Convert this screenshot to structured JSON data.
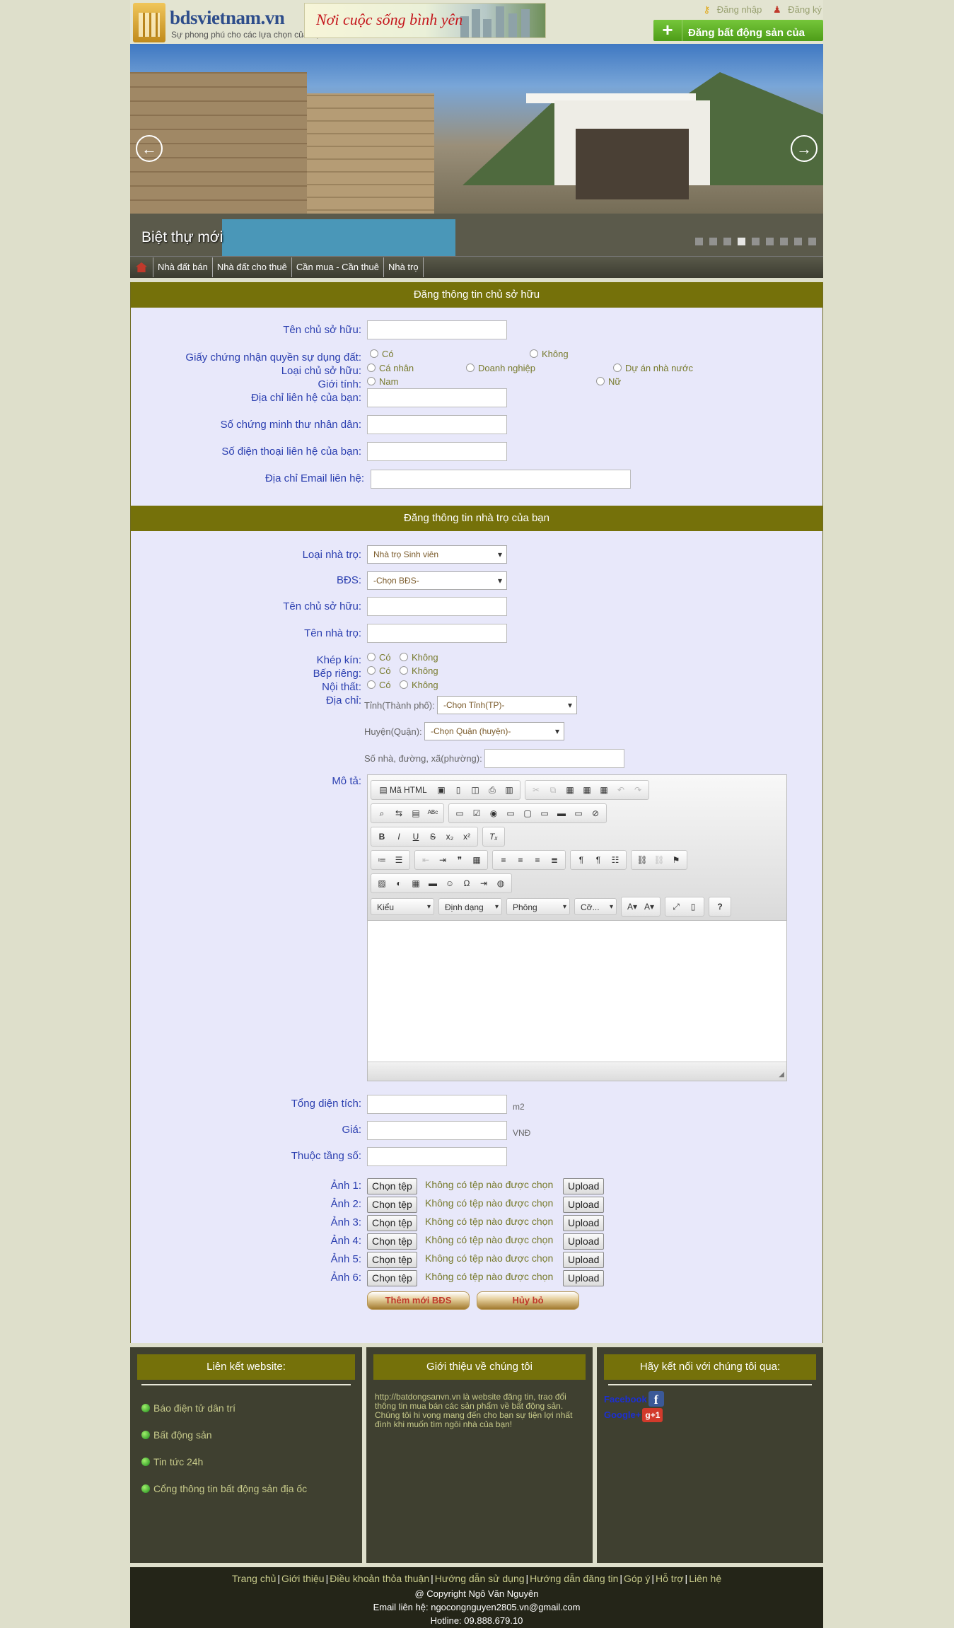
{
  "header": {
    "logo_name": "bdsvietnam.vn",
    "logo_slogan": "Sự phong phú cho các lựa chọn của bạn",
    "banner_text": "Nơi cuộc sống bình yên",
    "login": "Đăng nhập",
    "register": "Đăng ký",
    "post_button": "Đăng bất động sản của bạn"
  },
  "slider": {
    "caption": "Biệt thự mới",
    "dot_count": 9,
    "active_dot": 3
  },
  "nav": {
    "items": [
      "Nhà đất bán",
      "Nhà đất cho thuê",
      "Cần mua - Cần thuê",
      "Nhà trọ"
    ]
  },
  "owner_form": {
    "title": "Đăng thông tin chủ sở hữu",
    "owner_name_label": "Tên chủ sở hữu:",
    "certificate_label": "Giấy chứng nhận quyền sự dụng đất:",
    "certificate_options": [
      "Có",
      "Không"
    ],
    "owner_type_label": "Loại chủ sở hữu:",
    "owner_type_options": [
      "Cá nhân",
      "Doanh nghiệp",
      "Dự án nhà nước"
    ],
    "gender_label": "Giới tính:",
    "gender_options": [
      "Nam",
      "Nữ"
    ],
    "address_label": "Địa chỉ liên hệ của bạn:",
    "id_label": "Số chứng minh thư nhân dân:",
    "phone_label": "Số điện thoại liên hệ của bạn:",
    "email_label": "Địa chỉ Email liên hệ:"
  },
  "room_form": {
    "title": "Đăng thông tin nhà trọ của bạn",
    "room_type_label": "Loại nhà trọ:",
    "room_type_value": "Nhà trọ Sinh viên",
    "bds_label": "BĐS:",
    "bds_value": "-Chọn BĐS-",
    "owner_name_label": "Tên chủ sở hữu:",
    "room_name_label": "Tên nhà trọ:",
    "closed_label": "Khép kín:",
    "kitchen_label": "Bếp riêng:",
    "furniture_label": "Nội thất:",
    "yes": "Có",
    "no": "Không",
    "address_label": "Địa chỉ:",
    "province_label": "Tỉnh(Thành phố):",
    "province_value": "-Chọn Tỉnh(TP)-",
    "district_label": "Huyện(Quận):",
    "district_value": "-Chọn Quận (huyện)-",
    "street_label": "Số nhà, đường, xã(phường):",
    "description_label": "Mô tả:",
    "area_label": "Tổng diện tích:",
    "area_unit": "m2",
    "price_label": "Giá:",
    "price_unit": "VNĐ",
    "floor_label": "Thuộc tầng số:",
    "photo_labels": [
      "Ảnh 1:",
      "Ảnh 2:",
      "Ảnh 3:",
      "Ảnh 4:",
      "Ảnh 5:",
      "Ảnh 6:"
    ],
    "choose_file": "Chọn tệp",
    "no_file": "Không có tệp nào được chọn",
    "upload": "Upload",
    "submit": "Thêm mới BĐS",
    "cancel": "Hủy bỏ"
  },
  "editor": {
    "source_label": "Mã HTML",
    "combo_style": "Kiểu",
    "combo_format": "Định dạng",
    "combo_font": "Phông",
    "combo_size": "Cỡ..."
  },
  "footer": {
    "links_title": "Liên kết website:",
    "links": [
      "Báo điện tử dân trí",
      "Bất động sản",
      "Tin tức 24h",
      "Cổng thông tin bất động sản địa ốc"
    ],
    "about_title": "Giới thiệu về chúng tôi",
    "about_text": "http://batdongsanvn.vn là website đăng tin, trao đổi thông tin mua bán các sản phẩm về bất động sản. Chúng tôi hi vọng mang đến cho bạn sự tiện lợi nhất đình khi muốn tìm ngôi nhà của bạn!",
    "connect_title": "Hãy kết nối với chúng tôi qua:",
    "facebook": "Facebook",
    "google": "Google+",
    "google_badge": "+1",
    "bottom_links": [
      "Trang chủ",
      "Giới thiệu",
      "Điều khoản thỏa thuận",
      "Hướng dẫn sử dụng",
      "Hướng dẫn đăng tin",
      "Góp ý",
      "Hỗ trợ",
      "Liên hệ"
    ],
    "copyright": "@ Copyright Ngô Văn Nguyên",
    "email_line": "Email liên hệ: ngocongnguyen2805.vn@gmail.com",
    "hotline": "Hotline: 09.888.679.10"
  }
}
